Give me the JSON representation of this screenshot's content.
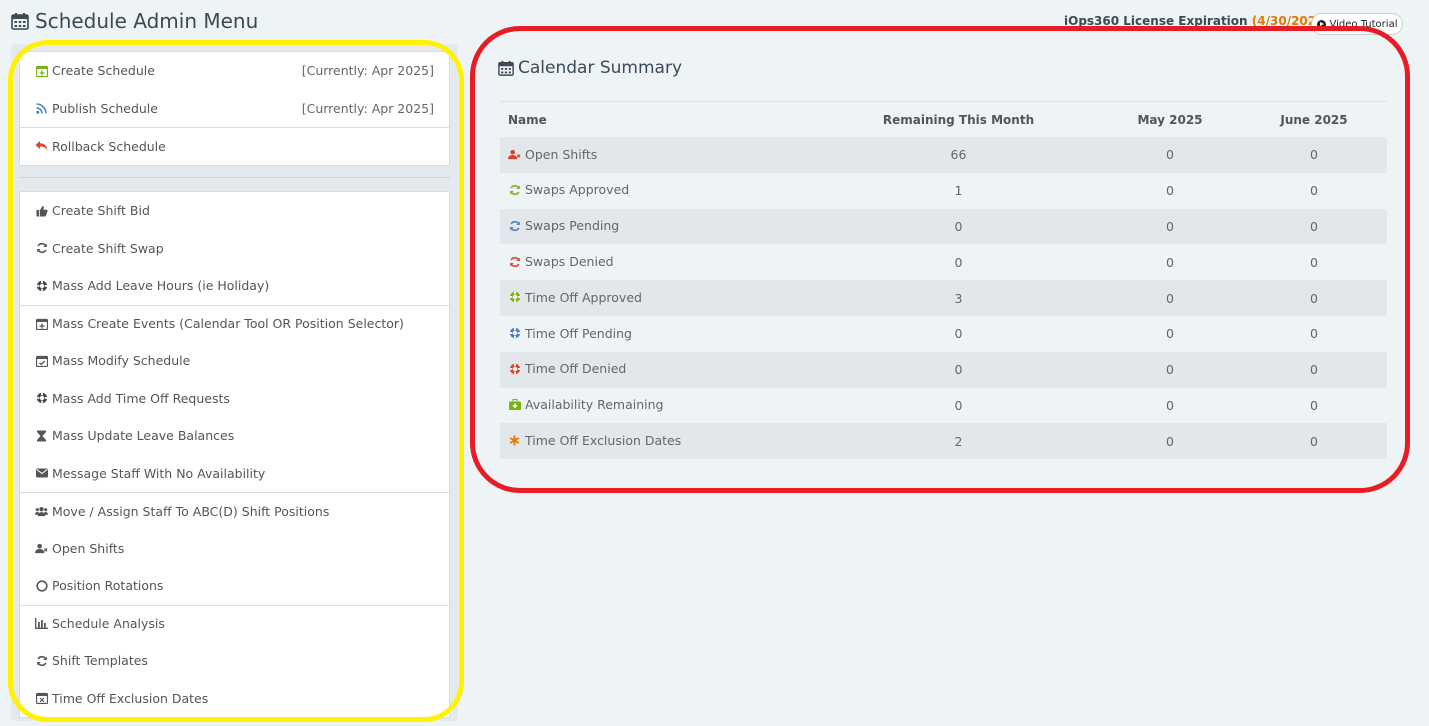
{
  "header": {
    "title": "Schedule Admin Menu",
    "license_label": "iOps360 License Expiration",
    "license_date": "(4/30/2025)",
    "video_button": "Video Tutorial"
  },
  "menu": {
    "group1": [
      {
        "label": "Create Schedule",
        "right": "[Currently: Apr 2025]",
        "icon": "calendar-plus-icon"
      },
      {
        "label": "Publish Schedule",
        "right": "[Currently: Apr 2025]",
        "icon": "rss-icon"
      },
      {
        "label": "Rollback Schedule",
        "right": "",
        "icon": "reply-icon"
      }
    ],
    "group2": [
      {
        "label": "Create Shift Bid",
        "icon": "thumbs-up-icon"
      },
      {
        "label": "Create Shift Swap",
        "icon": "refresh-icon"
      },
      {
        "label": "Mass Add Leave Hours (ie Holiday)",
        "icon": "life-ring-icon"
      },
      {
        "label": "Mass Create Events (Calendar Tool OR Position Selector)",
        "icon": "calendar-plus-icon"
      },
      {
        "label": "Mass Modify Schedule",
        "icon": "calendar-check-icon"
      },
      {
        "label": "Mass Add Time Off Requests",
        "icon": "life-ring-icon"
      },
      {
        "label": "Mass Update Leave Balances",
        "icon": "hourglass-icon"
      },
      {
        "label": "Message Staff With No Availability",
        "icon": "envelope-icon"
      },
      {
        "label": "Move / Assign Staff To ABC(D) Shift Positions",
        "icon": "users-icon"
      },
      {
        "label": "Open Shifts",
        "icon": "user-times-icon"
      },
      {
        "label": "Position Rotations",
        "icon": "circle-o-icon"
      },
      {
        "label": "Schedule Analysis",
        "icon": "bar-chart-icon"
      },
      {
        "label": "Shift Templates",
        "icon": "refresh-icon"
      },
      {
        "label": "Time Off Exclusion Dates",
        "icon": "calendar-times-icon"
      }
    ]
  },
  "summary": {
    "title": "Calendar Summary",
    "columns": [
      "Name",
      "Remaining This Month",
      "May 2025",
      "June 2025"
    ],
    "rows": [
      {
        "name": "Open Shifts",
        "icon": "user-times-icon",
        "color": "#d9452b",
        "remaining": "66",
        "may": "0",
        "june": "0"
      },
      {
        "name": "Swaps Approved",
        "icon": "refresh-icon",
        "color": "#7ab317",
        "remaining": "1",
        "may": "0",
        "june": "0"
      },
      {
        "name": "Swaps Pending",
        "icon": "refresh-icon",
        "color": "#4a7fc1",
        "remaining": "0",
        "may": "0",
        "june": "0"
      },
      {
        "name": "Swaps Denied",
        "icon": "refresh-icon",
        "color": "#d9452b",
        "remaining": "0",
        "may": "0",
        "june": "0"
      },
      {
        "name": "Time Off Approved",
        "icon": "life-ring-icon",
        "color": "#7ab317",
        "remaining": "3",
        "may": "0",
        "june": "0"
      },
      {
        "name": "Time Off Pending",
        "icon": "life-ring-icon",
        "color": "#4a7fc1",
        "remaining": "0",
        "may": "0",
        "june": "0"
      },
      {
        "name": "Time Off Denied",
        "icon": "life-ring-icon",
        "color": "#d9452b",
        "remaining": "0",
        "may": "0",
        "june": "0"
      },
      {
        "name": "Availability Remaining",
        "icon": "medkit-icon",
        "color": "#7ab317",
        "remaining": "0",
        "may": "0",
        "june": "0"
      },
      {
        "name": "Time Off Exclusion Dates",
        "icon": "asterisk-icon",
        "color": "#e07b00",
        "remaining": "2",
        "may": "0",
        "june": "0"
      }
    ]
  }
}
